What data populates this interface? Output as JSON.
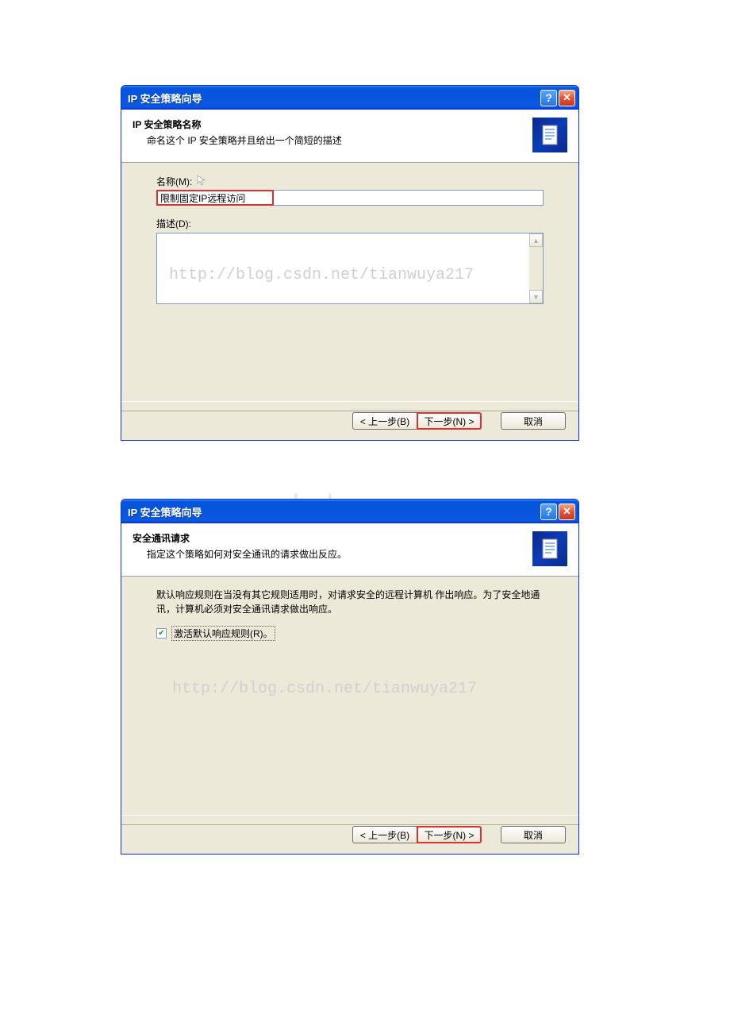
{
  "bg_watermark": "www.bdocx.com",
  "dialog1": {
    "title": "IP 安全策略向导",
    "header_title": "IP 安全策略名称",
    "header_subtitle": "命名这个 IP 安全策略并且给出一个简短的描述",
    "name_label": "名称(M):",
    "name_value": "限制固定IP远程访问",
    "desc_label": "描述(D):",
    "watermark": "http://blog.csdn.net/tianwuya217",
    "btn_back": "< 上一步(B)",
    "btn_next": "下一步(N) >",
    "btn_cancel": "取消"
  },
  "dialog2": {
    "title": "IP 安全策略向导",
    "header_title": "安全通讯请求",
    "header_subtitle": "指定这个策略如何对安全通讯的请求做出反应。",
    "info_text": "默认响应规则在当没有其它规则适用时，对请求安全的远程计算机 作出响应。为了安全地通讯，计算机必须对安全通讯请求做出响应。",
    "checkbox_label": "激活默认响应规则(R)。",
    "watermark": "http://blog.csdn.net/tianwuya217",
    "btn_back": "< 上一步(B)",
    "btn_next": "下一步(N) >",
    "btn_cancel": "取消"
  }
}
